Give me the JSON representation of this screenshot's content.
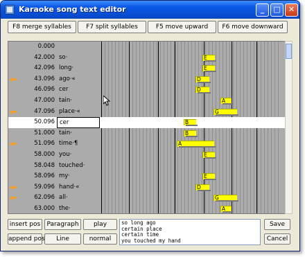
{
  "window": {
    "title": "Karaoke song text editor"
  },
  "toolbar": {
    "merge": "F8 merge syllables",
    "split": "F7 split syllables",
    "up": "F5 move upward",
    "down": "F6 move downward"
  },
  "rows": [
    {
      "time": "0.000",
      "text": "",
      "arrow": false,
      "selected": false
    },
    {
      "time": "42.000",
      "text": "so·",
      "arrow": false,
      "selected": false,
      "note": "E"
    },
    {
      "time": "42.096",
      "text": "long·",
      "arrow": false,
      "selected": false,
      "note": "E"
    },
    {
      "time": "43.096",
      "text": "ago·«",
      "arrow": true,
      "selected": false,
      "note": "D"
    },
    {
      "time": "46.096",
      "text": "cer",
      "arrow": false,
      "selected": false,
      "note": "D"
    },
    {
      "time": "47.000",
      "text": "tain·",
      "arrow": false,
      "selected": false,
      "note": "A"
    },
    {
      "time": "47.096",
      "text": "place·«",
      "arrow": true,
      "selected": false,
      "note": "G"
    },
    {
      "time": "50.096",
      "text": "cer",
      "arrow": false,
      "selected": true,
      "note": "B"
    },
    {
      "time": "51.000",
      "text": "tain·",
      "arrow": false,
      "selected": false,
      "note": "B"
    },
    {
      "time": "51.096",
      "text": "time·¶",
      "arrow": true,
      "selected": false,
      "note": "A"
    },
    {
      "time": "58.000",
      "text": "you·",
      "arrow": false,
      "selected": false,
      "note": "E"
    },
    {
      "time": "58.048",
      "text": "touched·",
      "arrow": false,
      "selected": false,
      "note": ""
    },
    {
      "time": "58.096",
      "text": "my·",
      "arrow": false,
      "selected": false,
      "note": "E"
    },
    {
      "time": "59.096",
      "text": "hand·«",
      "arrow": true,
      "selected": false,
      "note": "D"
    },
    {
      "time": "62.096",
      "text": "all·",
      "arrow": true,
      "selected": false,
      "note": "G"
    },
    {
      "time": "63.000",
      "text": "the·",
      "arrow": false,
      "selected": false,
      "note": "A"
    }
  ],
  "buttons": {
    "insert_pos": "insert pos",
    "paragraph": "Paragraph",
    "play": "play",
    "append_pos": "append pos",
    "line": "Line",
    "normal": "normal",
    "save": "Save",
    "cancel": "Cancel"
  },
  "lyrics": "so long ago\ncertain place\ncertain time\nyou touched my hand",
  "colors": {
    "note_bar": "#ffff00",
    "grid_bg": "#ababab",
    "titlebar": "#0a4fd6"
  }
}
